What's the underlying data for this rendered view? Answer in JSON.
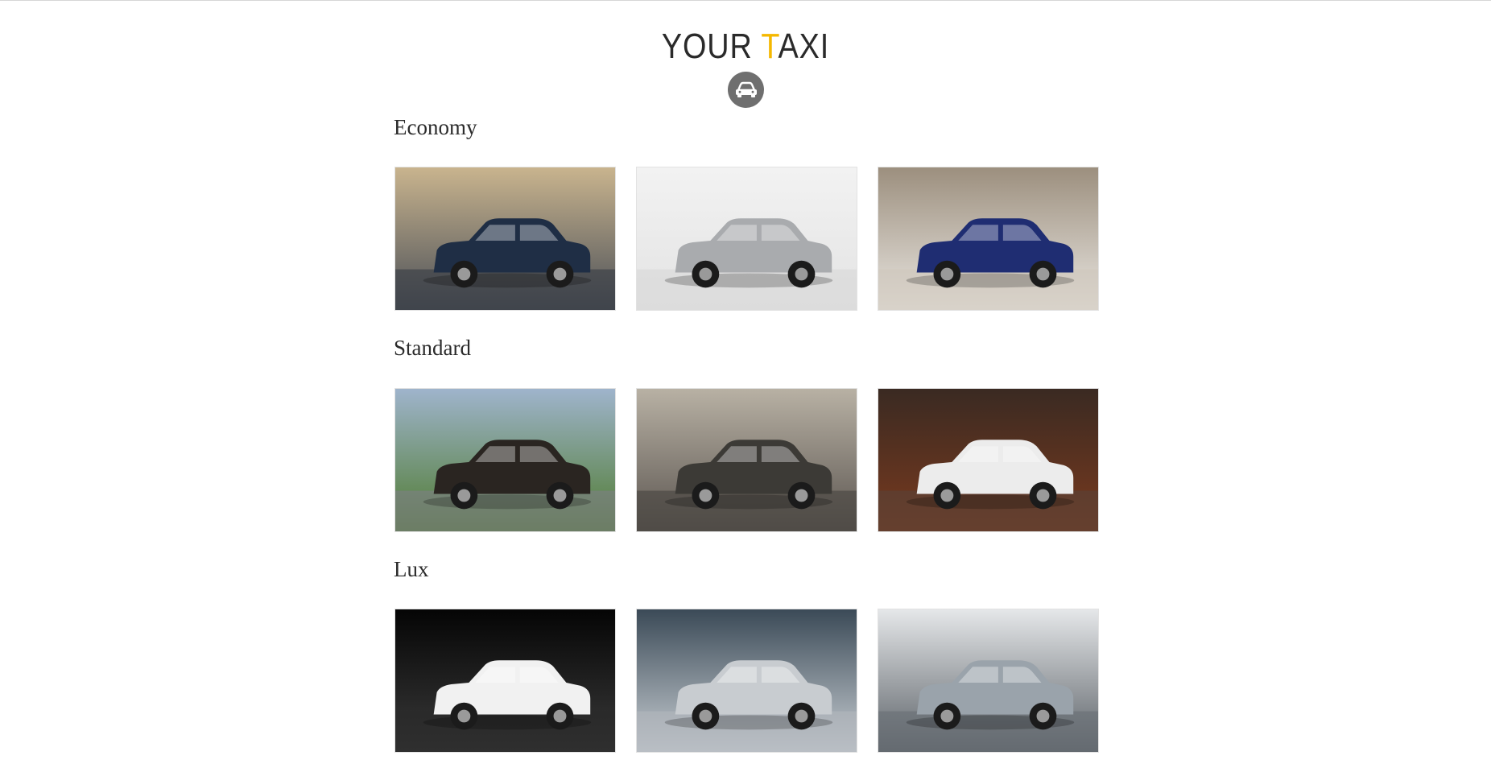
{
  "brand": {
    "prefix": "YOUR ",
    "accent_letter": "T",
    "suffix": "AXI",
    "accent_color": "#f5b800",
    "badge_icon": "car-icon"
  },
  "sections": [
    {
      "title": "Economy",
      "cars": [
        {
          "body": "#1f2e45",
          "bg_top": "#c9b48e",
          "bg_bottom": "#4a4f57",
          "road": "#3b3f46"
        },
        {
          "body": "#a9abae",
          "bg_top": "#f2f2f2",
          "bg_bottom": "#e3e3e3",
          "road": "#d9d9d9"
        },
        {
          "body": "#1f2d72",
          "bg_top": "#9c8f7e",
          "bg_bottom": "#e9e6e1",
          "road": "#cfc8bd"
        }
      ]
    },
    {
      "title": "Standard",
      "cars": [
        {
          "body": "#2a2521",
          "bg_top": "#9fb4cc",
          "bg_bottom": "#4e7a2e",
          "road": "#7d7f83"
        },
        {
          "body": "#3c3a36",
          "bg_top": "#b8b1a4",
          "bg_bottom": "#5b5550",
          "road": "#4a4642"
        },
        {
          "body": "#ececec",
          "bg_top": "#3a2a22",
          "bg_bottom": "#7a3a1e",
          "road": "#5a4237"
        }
      ]
    },
    {
      "title": "Lux",
      "cars": [
        {
          "body": "#f1f1f1",
          "bg_top": "#050505",
          "bg_bottom": "#3a3a3a",
          "road": "#2a2a2a"
        },
        {
          "body": "#c8ccd0",
          "bg_top": "#3b4a57",
          "bg_bottom": "#c9cfd4",
          "road": "#b0b6bb"
        },
        {
          "body": "#9aa3ab",
          "bg_top": "#e5e7e9",
          "bg_bottom": "#5a6066",
          "road": "#6a7076"
        }
      ]
    }
  ]
}
